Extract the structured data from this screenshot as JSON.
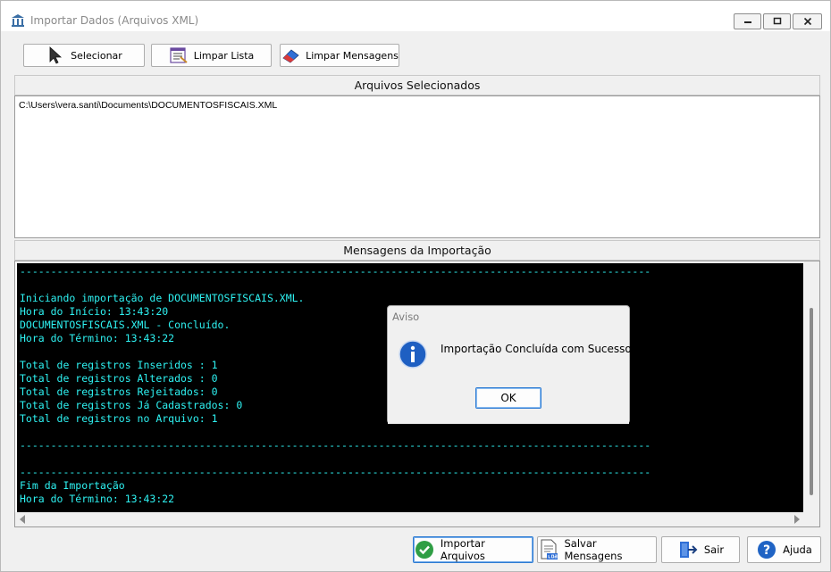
{
  "window": {
    "title": "Importar Dados (Arquivos XML)"
  },
  "toolbar": {
    "select_label": "Selecionar",
    "clear_list_label": "Limpar Lista",
    "clear_messages_label": "Limpar Mensagens"
  },
  "files_section": {
    "header": "Arquivos Selecionados",
    "items": [
      "C:\\Users\\vera.santi\\Documents\\DOCUMENTOSFISCAIS.XML"
    ]
  },
  "messages_section": {
    "header": "Mensagens da Importação",
    "lines": [
      "------------------------------------------------------------------------------------------------------",
      "",
      "Iniciando importação de DOCUMENTOSFISCAIS.XML.",
      "Hora do Início: 13:43:20",
      "DOCUMENTOSFISCAIS.XML - Concluído.",
      "Hora do Término: 13:43:22",
      "",
      "Total de registros Inseridos : 1",
      "Total de registros Alterados : 0",
      "Total de registros Rejeitados: 0",
      "Total de registros Já Cadastrados: 0",
      "Total de registros no Arquivo: 1",
      "",
      "------------------------------------------------------------------------------------------------------",
      "",
      "------------------------------------------------------------------------------------------------------",
      "Fim da Importação",
      "Hora do Término: 13:43:22"
    ]
  },
  "bottom_bar": {
    "import_label": "Importar Arquivos",
    "save_label": "Salvar Mensagens",
    "exit_label": "Sair",
    "help_label": "Ajuda"
  },
  "dialog": {
    "title": "Aviso",
    "message": "Importação Concluída com Sucesso!",
    "ok_label": "OK",
    "icon": "info-icon"
  },
  "colors": {
    "console_bg": "#000000",
    "console_text": "#2ef2f2",
    "accent": "#2d7bd3"
  }
}
